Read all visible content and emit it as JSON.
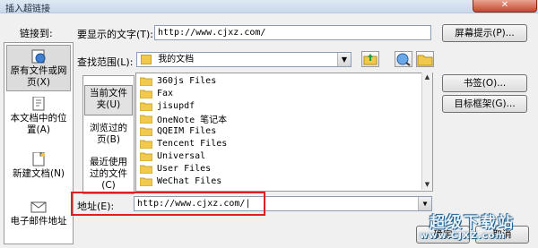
{
  "window": {
    "title": "插入超链接",
    "close_glyph": "✕"
  },
  "link_to": {
    "label": "链接到:",
    "items": [
      {
        "label": "原有文件或网页(X)",
        "line1": "原有文件或网",
        "line2": "页(X)",
        "icon": "web-page-icon",
        "selected": true
      },
      {
        "label": "本文档中的位置(A)",
        "line1": "本文档中的位",
        "line2": "置(A)",
        "icon": "document-place-icon",
        "selected": false
      },
      {
        "label": "新建文档(N)",
        "line1": "新建文档(N)",
        "line2": "",
        "icon": "new-document-icon",
        "selected": false
      },
      {
        "label": "电子邮件地址",
        "line1": "电子邮件地址",
        "line2": "",
        "icon": "email-icon",
        "selected": false
      }
    ]
  },
  "text_to_display": {
    "label": "要显示的文字(T):",
    "value": "http://www.cjxz.com/"
  },
  "screen_tip_button": "屏幕提示(P)...",
  "look_in": {
    "label": "查找范围(L):",
    "value": "我的文档"
  },
  "places": [
    {
      "line1": "当前文件",
      "line2": "夹(U)",
      "line3": "",
      "selected": true
    },
    {
      "line1": "浏览过的",
      "line2": "页(B)",
      "line3": "",
      "selected": false
    },
    {
      "line1": "最近使用",
      "line2": "过的文件",
      "line3": "(C)",
      "selected": false
    }
  ],
  "files": [
    "360js Files",
    "Fax",
    "jisupdf",
    "OneNote 笔记本",
    "QQEIM Files",
    "Tencent Files",
    "Universal",
    "User Files",
    "WeChat Files"
  ],
  "bookmark_button": "书签(O)...",
  "target_frame_button": "目标框架(G)...",
  "address": {
    "label": "地址(E):",
    "value": "http://www.cjxz.com/"
  },
  "ok_button": "确定",
  "cancel_button": "取消",
  "watermark": {
    "line1": "超级下载站",
    "line2": "www.CJXZ.com"
  },
  "colors": {
    "highlight": "#e02020",
    "folder": "#f2c94c",
    "title_bar": "#c9d8ec"
  }
}
